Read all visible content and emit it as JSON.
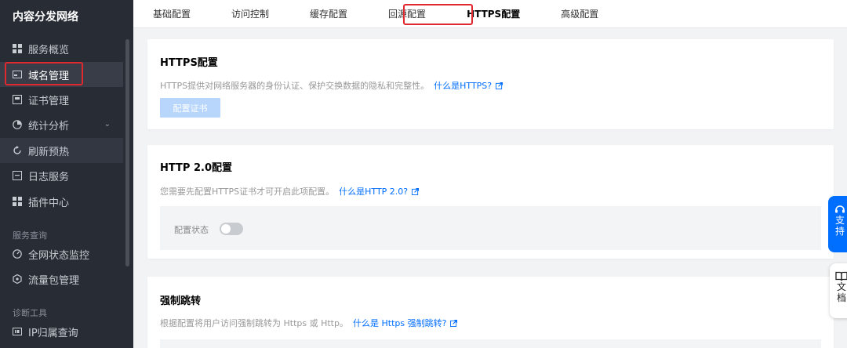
{
  "sidebar": {
    "title": "内容分发网络",
    "items": [
      {
        "label": "服务概览",
        "icon": "grid-icon"
      },
      {
        "label": "域名管理",
        "icon": "domain-icon"
      },
      {
        "label": "证书管理",
        "icon": "certificate-icon"
      },
      {
        "label": "统计分析",
        "icon": "pie-chart-icon"
      },
      {
        "label": "刷新预热",
        "icon": "refresh-icon"
      },
      {
        "label": "日志服务",
        "icon": "log-icon"
      },
      {
        "label": "插件中心",
        "icon": "plugin-icon"
      }
    ],
    "section1": "服务查询",
    "items2": [
      {
        "label": "全网状态监控",
        "icon": "monitor-icon"
      },
      {
        "label": "流量包管理",
        "icon": "package-icon"
      }
    ],
    "section2": "诊断工具",
    "items3": [
      {
        "label": "IP归属查询",
        "icon": "ip-icon"
      }
    ]
  },
  "tabs": [
    "基础配置",
    "访问控制",
    "缓存配置",
    "回源配置",
    "HTTPS配置",
    "高级配置"
  ],
  "https_card": {
    "title": "HTTPS配置",
    "desc": "HTTPS提供对网络服务器的身份认证、保护交换数据的隐私和完整性。",
    "link": "什么是HTTPS?",
    "button": "配置证书"
  },
  "http2_card": {
    "title": "HTTP 2.0配置",
    "desc": "您需要先配置HTTPS证书才可开启此项配置。",
    "link": "什么是HTTP 2.0?",
    "status_label": "配置状态"
  },
  "force_card": {
    "title": "强制跳转",
    "desc": "根据配置将用户访问强制跳转为 Https 或 Http。",
    "link": "什么是 Https 强制跳转?"
  },
  "float": {
    "support_chars": [
      "支",
      "持"
    ],
    "docs_chars": [
      "文",
      "档"
    ]
  },
  "colors": {
    "sidebar_bg": "#282c34",
    "accent": "#006eff",
    "highlight_box": "#e0282e"
  }
}
